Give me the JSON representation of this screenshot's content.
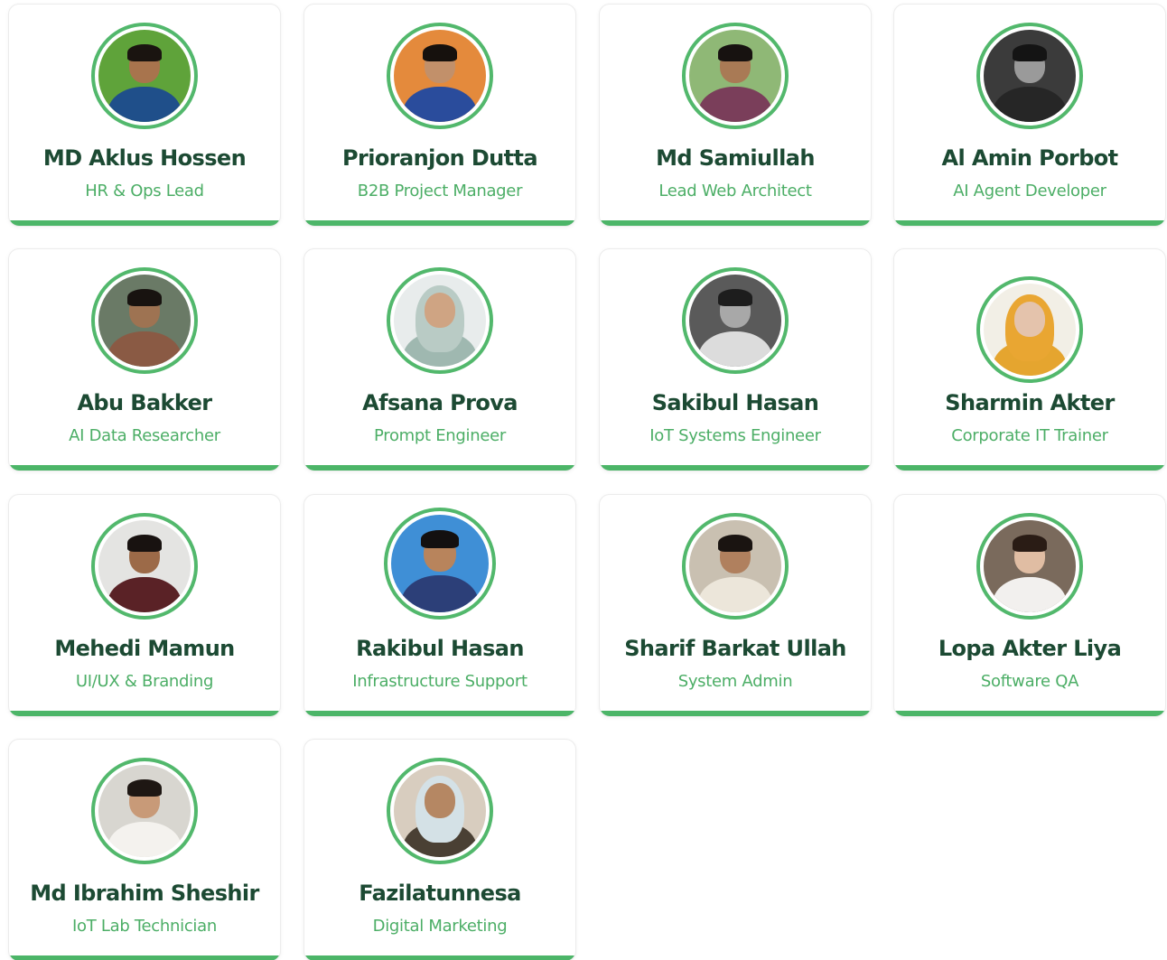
{
  "team": [
    {
      "name": "MD Aklus Hossen",
      "role": "HR & Ops Lead",
      "photo": {
        "bg": "#5fa33a",
        "skin": "#a8744d",
        "hair": "#1a1410",
        "shirt": "#1f4f8a"
      }
    },
    {
      "name": "Prioranjon Dutta",
      "role": "B2B Project Manager",
      "photo": {
        "bg": "#e48a3c",
        "skin": "#c2906a",
        "hair": "#16110d",
        "shirt": "#2a4c9c"
      }
    },
    {
      "name": "Md Samiullah",
      "role": "Lead Web Architect",
      "photo": {
        "bg": "#8fb876",
        "skin": "#a97a55",
        "hair": "#171210",
        "shirt": "#7a3e5a"
      }
    },
    {
      "name": "Al Amin Porbot",
      "role": "AI Agent Developer",
      "photo": {
        "bg": "#3b3b3b",
        "skin": "#9a9a9a",
        "hair": "#141414",
        "shirt": "#262626"
      }
    },
    {
      "name": "Abu Bakker",
      "role": "AI Data Researcher",
      "photo": {
        "bg": "#6a7a66",
        "skin": "#9e7352",
        "hair": "#181310",
        "shirt": "#8a5a44"
      }
    },
    {
      "name": "Afsana Prova",
      "role": "Prompt Engineer",
      "photo": {
        "bg": "#e8ecec",
        "skin": "#cfa483",
        "hair": "#b8c9c4",
        "shirt": "#9fb8b0",
        "hijab": "#b9cbc5"
      }
    },
    {
      "name": "Sakibul Hasan",
      "role": "IoT Systems Engineer",
      "photo": {
        "bg": "#5a5a5a",
        "skin": "#a8a8a8",
        "hair": "#1d1d1d",
        "shirt": "#dcdcdc"
      }
    },
    {
      "name": "Sharmin Akter",
      "role": "Corporate IT Trainer",
      "photo": {
        "bg": "#f2efe6",
        "skin": "#e4c3ac",
        "hair": "#e39b2c",
        "shirt": "#e5a52f",
        "hijab": "#e9a632"
      }
    },
    {
      "name": "Mehedi Mamun",
      "role": "UI/UX & Branding",
      "photo": {
        "bg": "#e4e4e2",
        "skin": "#9c6a48",
        "hair": "#181210",
        "shirt": "#5a2226"
      }
    },
    {
      "name": "Rakibul Hasan",
      "role": "Infrastructure Support",
      "photo": {
        "bg": "#3f8fd6",
        "skin": "#b8845c",
        "hair": "#131010",
        "shirt": "#2c3f78"
      }
    },
    {
      "name": "Sharif Barkat Ullah",
      "role": "System Admin",
      "photo": {
        "bg": "#c9c0b1",
        "skin": "#b0805e",
        "hair": "#1a1411",
        "shirt": "#ece6da"
      }
    },
    {
      "name": "Lopa Akter Liya",
      "role": "Software QA",
      "photo": {
        "bg": "#7a6a5c",
        "skin": "#e0bda3",
        "hair": "#2a1c15",
        "shirt": "#f2f0ee"
      }
    },
    {
      "name": "Md Ibrahim Sheshir",
      "role": "IoT Lab Technician",
      "photo": {
        "bg": "#d8d6d0",
        "skin": "#c89a78",
        "hair": "#1e1713",
        "shirt": "#f4f2ee"
      }
    },
    {
      "name": "Fazilatunnesa",
      "role": "Digital Marketing",
      "photo": {
        "bg": "#d8cdbf",
        "skin": "#b58763",
        "hair": "#d6e2e6",
        "shirt": "#4a4034",
        "hijab": "#d4e1e6"
      }
    }
  ]
}
